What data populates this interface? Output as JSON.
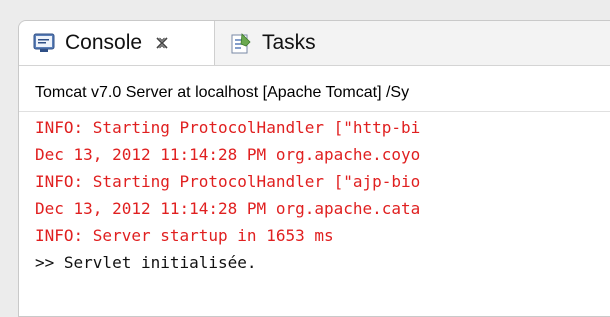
{
  "tabs": [
    {
      "label": "Console",
      "icon": "console-icon",
      "active": true
    },
    {
      "label": "Tasks",
      "icon": "tasks-icon",
      "active": false
    }
  ],
  "console": {
    "header": "Tomcat v7.0 Server at localhost [Apache Tomcat] /Sy",
    "lines": [
      {
        "text": "INFO: Starting ProtocolHandler [\"http-bi",
        "stream": "err"
      },
      {
        "text": "Dec 13, 2012 11:14:28 PM org.apache.coyo",
        "stream": "err"
      },
      {
        "text": "INFO: Starting ProtocolHandler [\"ajp-bio",
        "stream": "err"
      },
      {
        "text": "Dec 13, 2012 11:14:28 PM org.apache.cata",
        "stream": "err"
      },
      {
        "text": "INFO: Server startup in 1653 ms",
        "stream": "err"
      },
      {
        "text": ">> Servlet initialisée.",
        "stream": "out"
      }
    ]
  },
  "colors": {
    "stderr": "#e02020",
    "stdout": "#111111"
  }
}
